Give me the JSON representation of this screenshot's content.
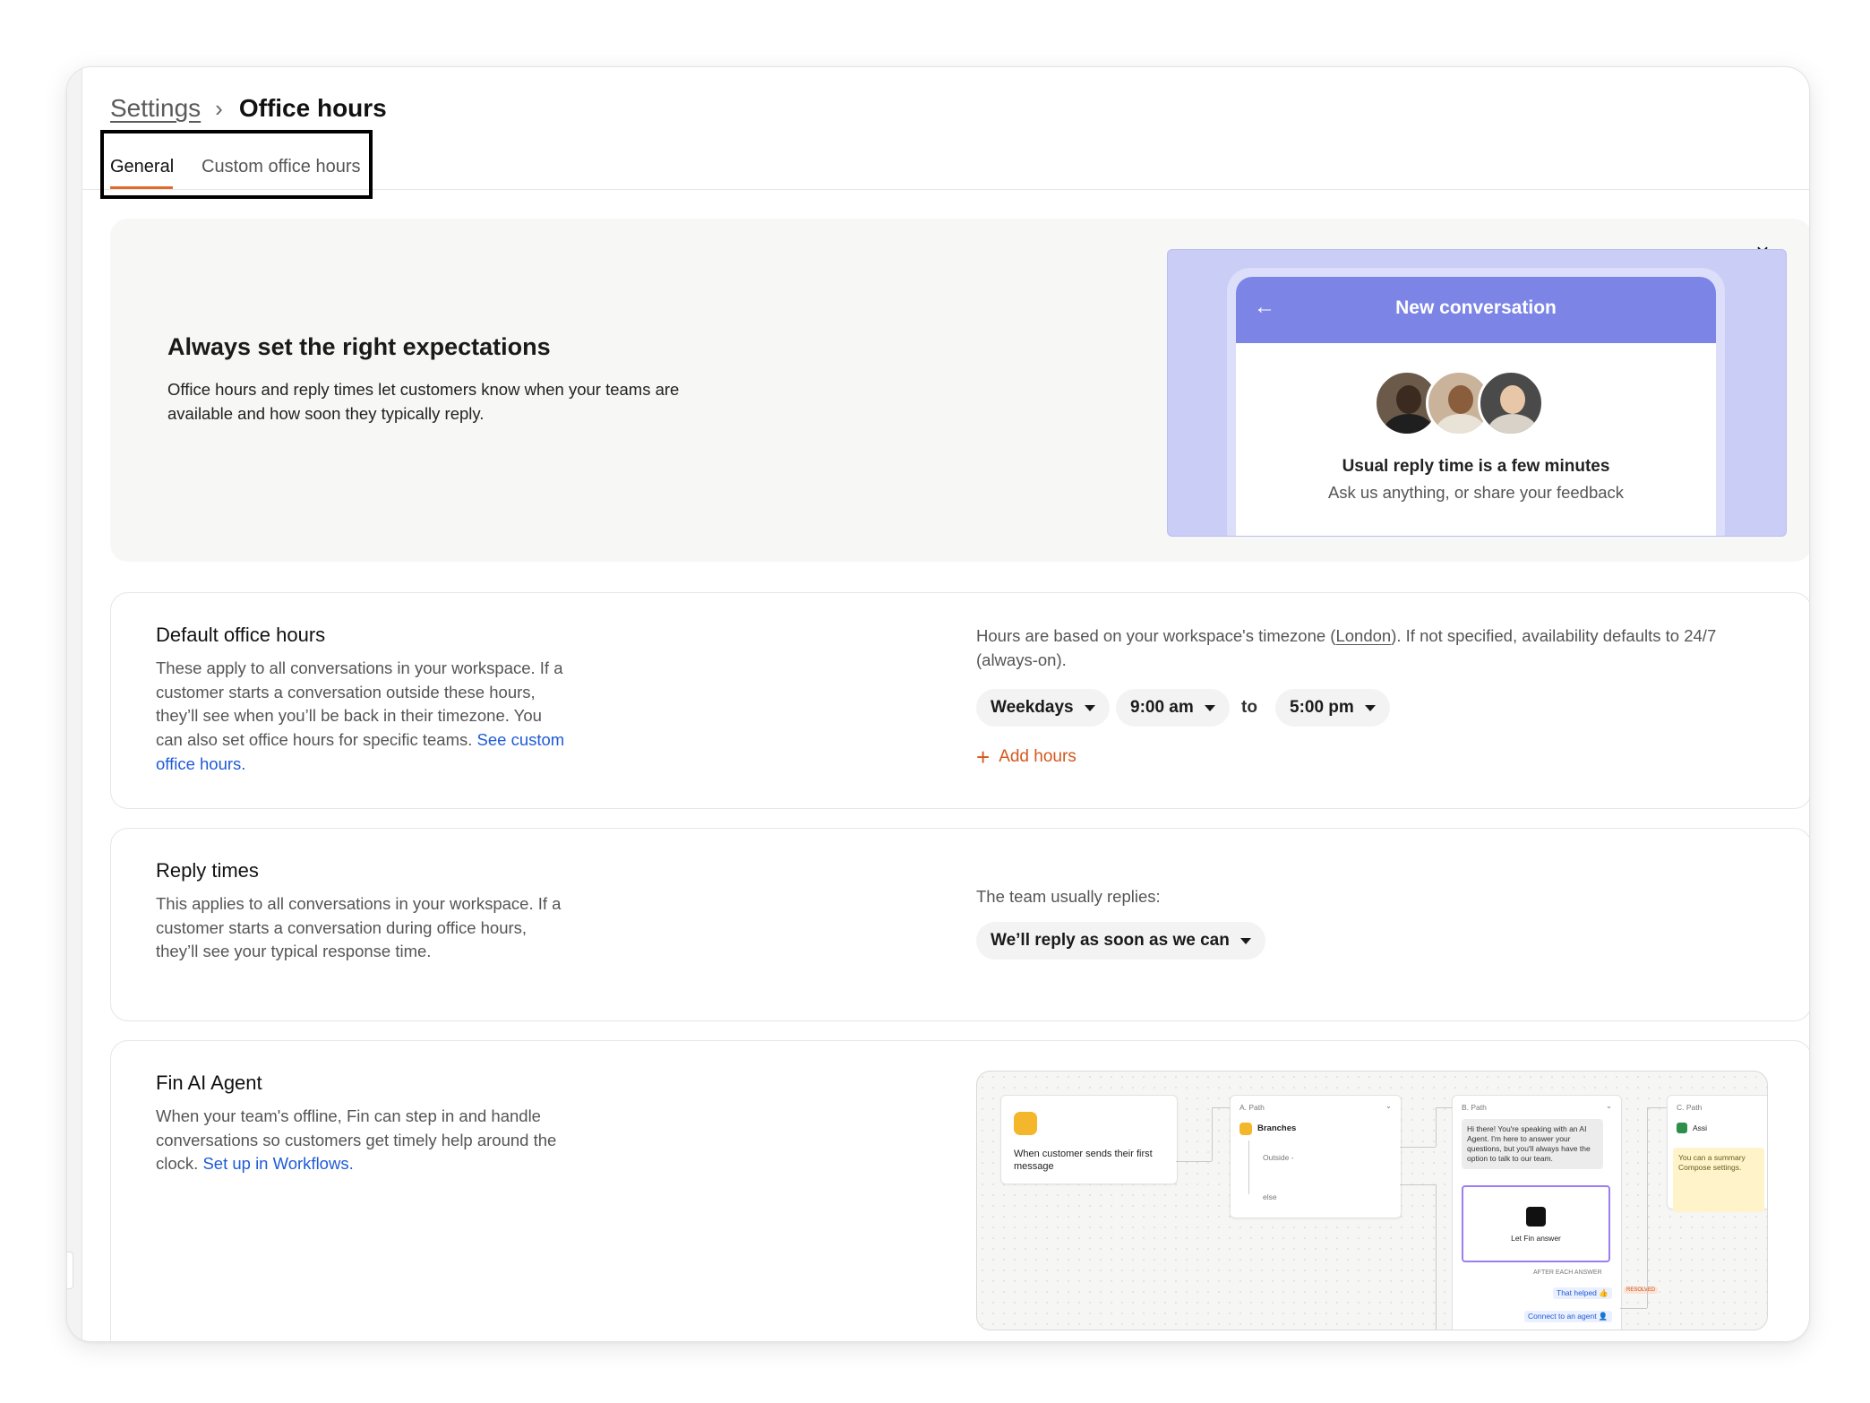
{
  "breadcrumb": {
    "root": "Settings",
    "separator": "›",
    "current": "Office hours"
  },
  "tabs": [
    {
      "label": "General",
      "active": true
    },
    {
      "label": "Custom office hours",
      "active": false
    }
  ],
  "hero": {
    "title": "Always set the right expectations",
    "description": "Office hours and reply times let customers know when your teams are available and how soon they typically reply.",
    "close_icon": "×",
    "preview": {
      "header_title": "New conversation",
      "back_icon": "←",
      "reply_title": "Usual reply time is a few minutes",
      "reply_subtitle": "Ask us anything, or share your feedback"
    }
  },
  "default_hours": {
    "title": "Default office hours",
    "description": "These apply to all conversations in your workspace. If a customer starts a conversation outside these hours, they’ll see when you’ll be back in their timezone. You can also set office hours for specific teams. ",
    "link": "See custom office hours.",
    "info_before": "Hours are based on your workspace's timezone (",
    "timezone": "London",
    "info_after": "). If not specified, availability defaults to 24/7 (always-on).",
    "days": "Weekdays",
    "start": "9:00 am",
    "to": "to",
    "end": "5:00 pm",
    "add_hours": "Add hours"
  },
  "reply_times": {
    "title": "Reply times",
    "description": "This applies to all conversations in your workspace. If a customer starts a conversation during office hours, they’ll see your typical response time.",
    "label": "The team usually replies:",
    "value": "We’ll reply as soon as we can"
  },
  "fin": {
    "title": "Fin AI Agent",
    "description": "When your team's offline, Fin can step in and handle conversations so customers get timely help around the clock. ",
    "link": "Set up in Workflows.",
    "workflow": {
      "trigger": "When customer sends their first message",
      "path_a": "A. Path",
      "branches": "Branches",
      "outside": "Outside -",
      "else": "else",
      "path_b": "B. Path",
      "bot_message": "Hi there! You're speaking with an AI Agent. I'm here to answer your questions, but you'll always have the option to talk to our team.",
      "fin_answer": "Let Fin answer",
      "after_each": "AFTER EACH ANSWER",
      "helped": "That helped 👍",
      "resolved": "RESOLVED",
      "connect": "Connect to an agent 👤",
      "path_c": "C. Path",
      "assign": "Assi",
      "note": "You can a summary Compose settings."
    }
  },
  "colors": {
    "accent": "#e2692a",
    "link": "#1f5bd6",
    "preview_header": "#7c84e6",
    "preview_bg": "#cacdf6"
  }
}
